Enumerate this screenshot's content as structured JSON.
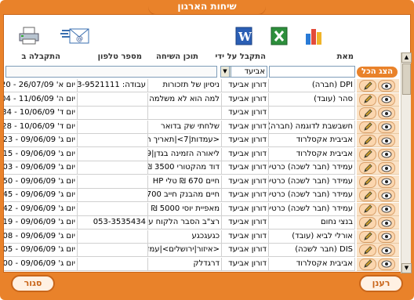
{
  "window": {
    "title": "שיחות הארגון"
  },
  "toolbar": {
    "icons": [
      "printer-icon",
      "email-icon",
      "word-icon",
      "excel-icon",
      "chart-icon"
    ]
  },
  "columns": {
    "who": "מאת",
    "receiver": "התקבל על ידי",
    "content": "תוכן השיחה",
    "phone": "מספר טלפון",
    "received": "התקבלה ב"
  },
  "filter": {
    "receiver_value": "אביעד",
    "show_all": "הצג הכל"
  },
  "rows": [
    {
      "who": "DPI (חברה)",
      "receiver": "דורון אביעד",
      "content": "ניסיון של תזכורות",
      "phone": "עבודה: 03-9521111",
      "received": "יום א' 26/07/09 - 20"
    },
    {
      "who": "סהר (עובד)",
      "receiver": "דורון אביעד",
      "content": "למה הוא לא משלמה",
      "phone": "",
      "received": "יום ה' 11/06/09 - 04"
    },
    {
      "who": "",
      "receiver": "דורון אביעד",
      "content": "",
      "phone": "",
      "received": "יום ד' 10/06/09 - 34"
    },
    {
      "who": "חשבשבת לדוגמה (חברה)",
      "receiver": "דורון אביעד",
      "content": "שלחתי שק בדואר",
      "phone": "",
      "received": "יום ד' 10/06/09 - 28"
    },
    {
      "who": "אביבית אקסלרוד",
      "receiver": "דורון אביעד",
      "content": "<עמדות|7>|תאריך הב",
      "phone": "",
      "received": "יום ג' 09/06/09 - 23"
    },
    {
      "who": "אביבית אקסלרוד",
      "receiver": "דורון אביעד",
      "content": "ליאורה הזמינה בגדן|9",
      "phone": "",
      "received": "יום ג' 09/06/09 - 15"
    },
    {
      "who": "עמידר (חבר לשכה) כרטיס 3",
      "receiver": "דורון אביעד",
      "content": "דוד מהקטורי 3500 ₪",
      "phone": "",
      "received": "יום ג' 09/06/09 - 03"
    },
    {
      "who": "עמידר (חבר לשכה) כרטיס 3",
      "receiver": "דורון אביעד",
      "content": "חיים 670 ₪ טלי HP",
      "phone": "",
      "received": "יום ג' 09/06/09 - 50"
    },
    {
      "who": "עמידר (חבר לשכה) כרטיס 3",
      "receiver": "דורון אביעד",
      "content": "חיים מהבנק חייב 700",
      "phone": "",
      "received": "יום ג' 09/06/09 - 45"
    },
    {
      "who": "עמידר (חבר לשכה) כרטיס 3",
      "receiver": "דורון אביעד",
      "content": "מאפיית יוסי 5000 ₪",
      "phone": "",
      "received": "יום ג' 09/06/09 - 42"
    },
    {
      "who": "בנצי נחום",
      "receiver": "דורון אביעד",
      "content": "רצ\"ב הסבר הלקוח על",
      "phone": "053-3535434",
      "received": "יום ג' 09/06/09 - 19"
    },
    {
      "who": "אורלי לביא (עובד)",
      "receiver": "דורון אביעד",
      "content": "כגעגכגע",
      "phone": "",
      "received": "יום ג' 09/06/09 - 08"
    },
    {
      "who": "DIS (חבר לשכה)",
      "receiver": "דורון אביעד",
      "content": "<איזור|ירושלים>|עמדו",
      "phone": "",
      "received": "יום ג' 09/06/09 - 05"
    },
    {
      "who": "אביבית אקסלרוד",
      "receiver": "דורון אביעד",
      "content": "דרגדלק",
      "phone": "",
      "received": "יום ג' 09/06/09 - 00"
    }
  ],
  "buttons": {
    "refresh": "רענן",
    "close": "סגור"
  }
}
